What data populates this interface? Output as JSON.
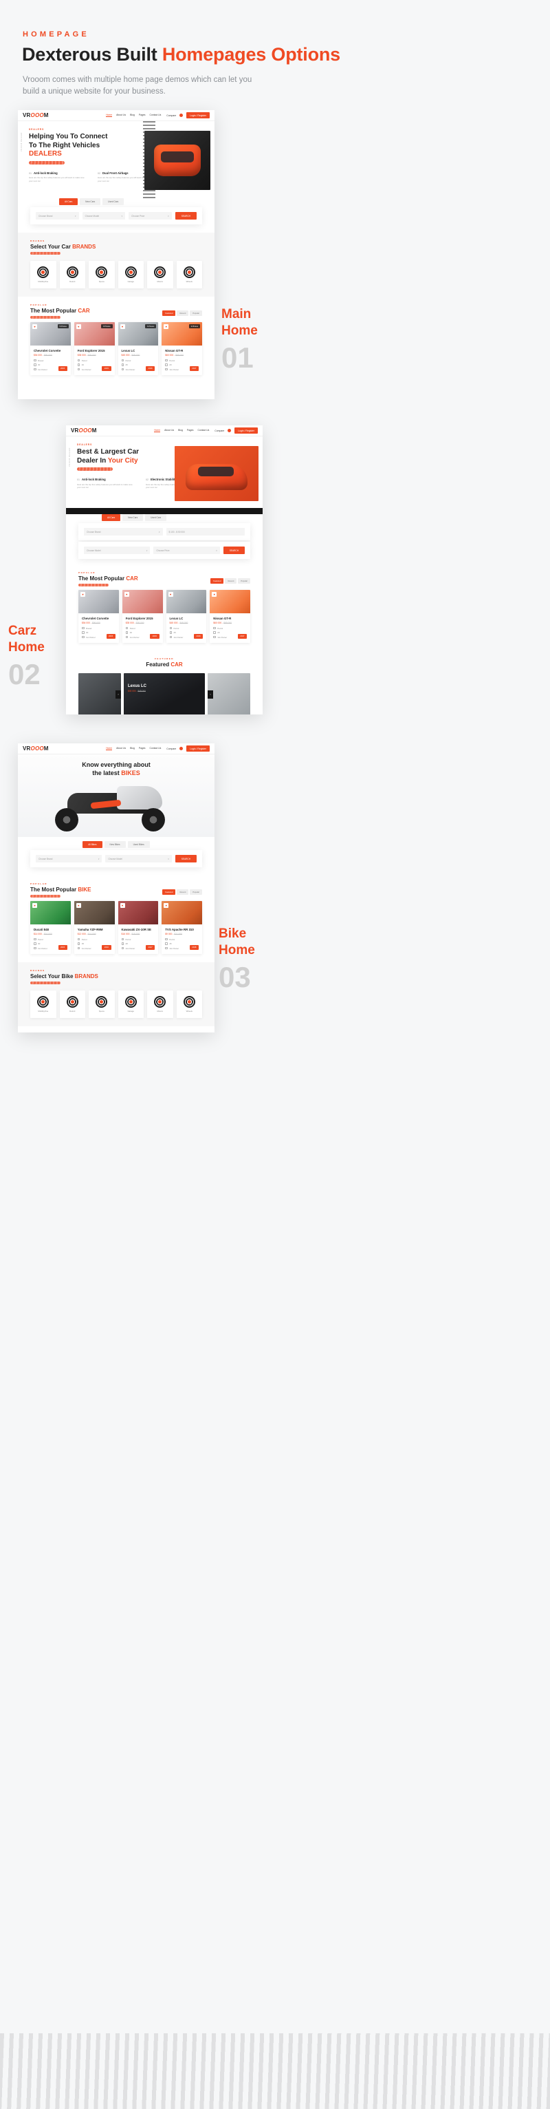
{
  "header": {
    "eyebrow": "HOMEPAGE",
    "title_main": "Dexterous Built ",
    "title_accent": "Homepages Options",
    "description": "Vrooom comes with multiple home page demos which can let you build a unique website for your business."
  },
  "accent_color": "#ef4a23",
  "labels": [
    {
      "name_line1": "Main",
      "name_line2": "Home",
      "number": "01"
    },
    {
      "name_line1": "Carz",
      "name_line2": "Home",
      "number": "02"
    },
    {
      "name_line1": "Bike",
      "name_line2": "Home",
      "number": "03"
    }
  ],
  "nav": {
    "logo_pre": "VR",
    "logo_mid": "OOO",
    "logo_post": "M",
    "links": [
      "Home",
      "About Us",
      "Blog",
      "Pages",
      "Contact Us"
    ],
    "compare": "Compare",
    "login": "Login / Register"
  },
  "mock1": {
    "hero": {
      "side_text": "VROOM DEALER",
      "eyebrow": "DEALERS",
      "line1": "Helping You To Connect",
      "line2": "To The Right Vehicles",
      "line3": "DEALERS",
      "features": [
        {
          "num": "01",
          "title": "Anti-lock Braking",
          "desc": "Here are the top five safety features you will want to make sure your next car"
        },
        {
          "num": "02",
          "title": "Dual Front Airbags",
          "desc": "Here are the top five safety features you will want to make sure your next car"
        }
      ]
    },
    "search": {
      "tabs": [
        "All Cars",
        "New Cars",
        "Used Cars"
      ],
      "active_tab": "All Cars",
      "brand_placeholder": "Choose Brand",
      "model_placeholder": "Choose Model",
      "price_placeholder": "Choose Price",
      "button": "SEARCH"
    },
    "brands_section": {
      "eyebrow": "BRANDS",
      "title_main": "Select Your Car ",
      "title_accent": "BRANDS",
      "items": [
        {
          "name": "MobilityOne"
        },
        {
          "name": "Detroit"
        },
        {
          "name": "Speca"
        },
        {
          "name": "Garage"
        },
        {
          "name": "Motors"
        },
        {
          "name": "Wheels"
        }
      ]
    },
    "popular_section": {
      "eyebrow": "POPULAR",
      "title_main": "The Most Popular ",
      "title_accent": "CAR",
      "tabs": [
        "Featured",
        "Recent",
        "Popular"
      ],
      "active_tab": "Featured",
      "cars": [
        {
          "name": "Chevrolet Corvette",
          "price": "$54 000",
          "old_price": "$56 000",
          "fuel": "Diesel",
          "mileage": "30",
          "owner": "1st-Owner",
          "year": "2015",
          "photos": "5 Photos"
        },
        {
          "name": "Ford Explorer 2015",
          "price": "$35 000",
          "old_price": "$38 000",
          "fuel": "Petrol",
          "mileage": "40",
          "owner": "1st-Owner",
          "year": "2015",
          "photos": "8 Photos"
        },
        {
          "name": "Lexus LC",
          "price": "$45 000",
          "old_price": "$48 000",
          "fuel": "Petrol",
          "mileage": "25",
          "owner": "1st-Owner",
          "year": "2016",
          "photos": "6 Photos"
        },
        {
          "name": "Nissan GT-R",
          "price": "$60 000",
          "old_price": "$65 000",
          "fuel": "Petrol",
          "mileage": "20",
          "owner": "1st-Owner",
          "year": "2017",
          "photos": "9 Photos"
        }
      ]
    }
  },
  "mock2": {
    "hero": {
      "side_text": "VROOM DEALER",
      "eyebrow": "DEALERS",
      "line1": "Best & Largest Car",
      "line2_main": "Dealer In ",
      "line2_accent": "Your City",
      "features": [
        {
          "num": "01",
          "title": "Anti-lock Braking",
          "desc": "Here are the top five safety features you will want to make sure your next car"
        },
        {
          "num": "02",
          "title": "Electronic Stability",
          "desc": "Here are the top five safety features you will want to make sure your next car"
        }
      ]
    },
    "search": {
      "tabs": [
        "All Cars",
        "New Cars",
        "Used Cars"
      ],
      "active_tab": "All Cars",
      "brand_placeholder": "Choose Brand",
      "model_placeholder": "Choose Model",
      "price_placeholder": "Choose Price",
      "price_range": "$ 100 - $ 50 000",
      "button": "SEARCH"
    },
    "popular_section": {
      "eyebrow": "POPULAR",
      "title_main": "The Most Popular ",
      "title_accent": "CAR",
      "tabs": [
        "Featured",
        "Recent",
        "Popular"
      ],
      "active_tab": "Featured",
      "cars": [
        {
          "name": "Chevrolet Corvette",
          "price": "$54 000",
          "old_price": "$56 000",
          "fuel": "Diesel",
          "mileage": "30",
          "owner": "1st-Owner",
          "year": "2015",
          "photos": "5 Photos"
        },
        {
          "name": "Ford Explorer 2015",
          "price": "$35 000",
          "old_price": "$38 000",
          "fuel": "Petrol",
          "mileage": "40",
          "owner": "1st-Owner",
          "year": "2015",
          "photos": "8 Photos"
        },
        {
          "name": "Lexus LC",
          "price": "$45 000",
          "old_price": "$48 000",
          "fuel": "Petrol",
          "mileage": "25",
          "owner": "1st-Owner",
          "year": "2016",
          "photos": "6 Photos"
        },
        {
          "name": "Nissan GT-R",
          "price": "$60 000",
          "old_price": "$65 000",
          "fuel": "Petrol",
          "mileage": "20",
          "owner": "1st-Owner",
          "year": "2017",
          "photos": "9 Photos"
        }
      ]
    },
    "featured_section": {
      "eyebrow": "FEATURED",
      "title_main": "Featured ",
      "title_accent": "CAR",
      "slide": {
        "name": "Lexus LC",
        "price": "$45 000",
        "old_price": "$48 000"
      },
      "prev": "‹",
      "next": "›"
    }
  },
  "mock3": {
    "hero": {
      "line1": "Know everything about",
      "line2_main": "the latest ",
      "line2_accent": "BIKES"
    },
    "search": {
      "tabs": [
        "All Bikes",
        "New Bikes",
        "Used Bikes"
      ],
      "active_tab": "All Bikes",
      "brand_placeholder": "Choose Brand",
      "model_placeholder": "Choose Model",
      "button": "SEARCH"
    },
    "popular_section": {
      "eyebrow": "POPULAR",
      "title_main": "The Most Popular ",
      "title_accent": "BIKE",
      "tabs": [
        "Featured",
        "Recent",
        "Popular"
      ],
      "active_tab": "Featured",
      "bikes": [
        {
          "name": "Ducati 848",
          "price": "$14 000",
          "old_price": "$16 000",
          "fuel": "Petrol",
          "mileage": "30",
          "owner": "1st-Owner",
          "year": "2015",
          "photos": "5 Photos"
        },
        {
          "name": "Yamaha YZF-R9M",
          "price": "$12 000",
          "old_price": "$14 000",
          "fuel": "Petrol",
          "mileage": "35",
          "owner": "1st-Owner",
          "year": "2016",
          "photos": "7 Photos"
        },
        {
          "name": "Kawasaki ZX-10R SE",
          "price": "$16 000",
          "old_price": "$18 000",
          "fuel": "Petrol",
          "mileage": "28",
          "owner": "1st-Owner",
          "year": "2017",
          "photos": "6 Photos"
        },
        {
          "name": "TVS Apache RR 310",
          "price": "$9 000",
          "old_price": "$11 000",
          "fuel": "Petrol",
          "mileage": "45",
          "owner": "1st-Owner",
          "year": "2018",
          "photos": "4 Photos"
        }
      ]
    },
    "brands_section": {
      "eyebrow": "BRANDS",
      "title_main": "Select Your Bike ",
      "title_accent": "BRANDS",
      "items": [
        {
          "name": "MobilityOne"
        },
        {
          "name": "Detroit"
        },
        {
          "name": "Speca"
        },
        {
          "name": "Garage"
        },
        {
          "name": "Motors"
        },
        {
          "name": "Wheels"
        }
      ]
    }
  }
}
